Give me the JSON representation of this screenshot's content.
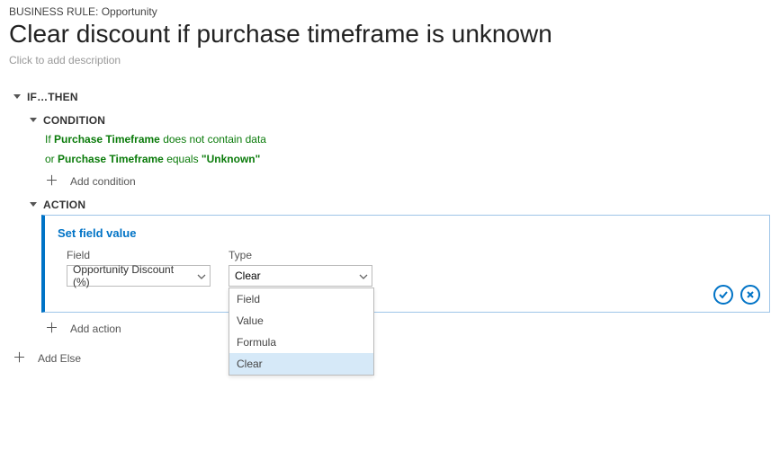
{
  "header": {
    "breadcrumb": "BUSINESS RULE: Opportunity",
    "title": "Clear discount if purchase timeframe is unknown",
    "description_placeholder": "Click to add description"
  },
  "ifthen": {
    "label": "IF…THEN",
    "condition": {
      "label": "CONDITION",
      "lines": [
        {
          "prefix": "If",
          "field": "Purchase Timeframe",
          "rest": "does not contain data"
        },
        {
          "prefix": "or",
          "field": "Purchase Timeframe",
          "rest_prefix": "equals",
          "rest_bold": "\"Unknown\""
        }
      ],
      "add_label": "Add condition"
    },
    "action": {
      "label": "ACTION",
      "panel_title": "Set field value",
      "field": {
        "label": "Field",
        "value": "Opportunity Discount (%)"
      },
      "type": {
        "label": "Type",
        "value": "Clear",
        "options": [
          "Field",
          "Value",
          "Formula",
          "Clear"
        ],
        "selected_index": 3
      },
      "add_label": "Add action"
    }
  },
  "add_else": "Add Else"
}
